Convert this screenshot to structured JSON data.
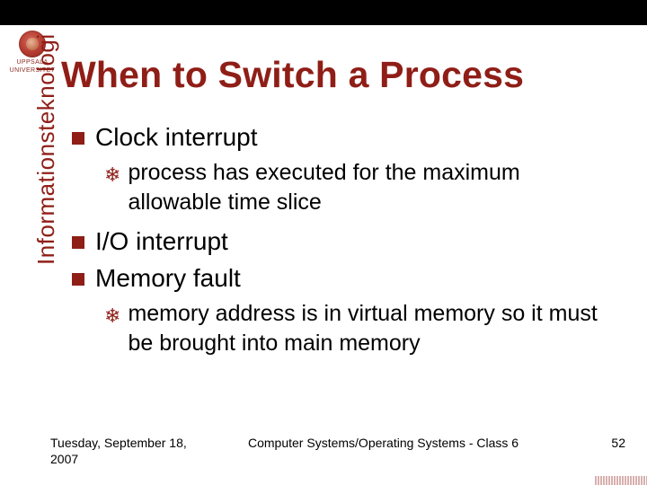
{
  "university": {
    "logo_line1": "UPPSALA",
    "logo_line2": "UNIVERSITET"
  },
  "slide": {
    "title": "When to Switch a Process",
    "sidebar_label": "Informationsteknologi"
  },
  "bullets": {
    "item1": "Clock interrupt",
    "item1_sub": "process has executed for the maximum allowable time slice",
    "item2": "I/O interrupt",
    "item3": "Memory fault",
    "item3_sub": "memory address is in virtual memory so it must be brought into main memory"
  },
  "footer": {
    "date": "Tuesday, September 18, 2007",
    "course": "Computer Systems/Operating Systems - Class 6",
    "page": "52"
  }
}
